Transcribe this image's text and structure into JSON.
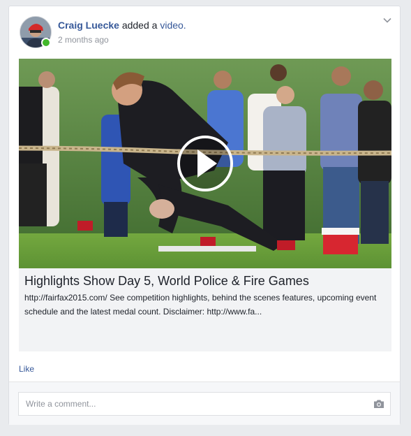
{
  "post": {
    "author": "Craig Luecke",
    "action_text": "added a",
    "object_link": "video.",
    "timestamp": "2 months ago",
    "status_color": "#42b72a"
  },
  "video": {
    "icon": "play-icon"
  },
  "preview": {
    "title": "Highlights Show Day 5, World Police & Fire Games",
    "description": "http://fairfax2015.com/ See competition highlights, behind the scenes features, upcoming event schedule and the latest medal count. Disclaimer: http://www.fa..."
  },
  "actions": {
    "like_label": "Like"
  },
  "comment": {
    "placeholder": "Write a comment...",
    "icon": "camera-icon"
  },
  "colors": {
    "link": "#365899",
    "page_bg": "#e9ebee",
    "preview_bg": "#f2f3f5"
  }
}
